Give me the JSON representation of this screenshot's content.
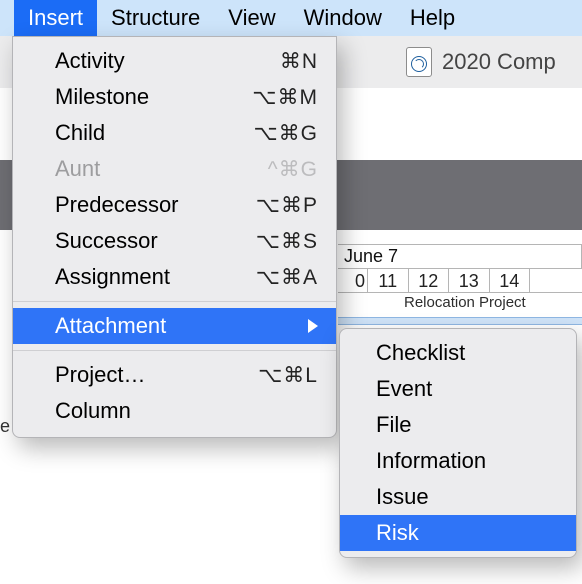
{
  "menubar": {
    "items": [
      {
        "label": "Insert",
        "active": true
      },
      {
        "label": "Structure"
      },
      {
        "label": "View"
      },
      {
        "label": "Window"
      },
      {
        "label": "Help"
      }
    ]
  },
  "toolbar": {
    "doc_title": "2020 Comp"
  },
  "calendar": {
    "month_label": "June 7",
    "days": [
      "0",
      "11",
      "12",
      "13",
      "14"
    ],
    "project_label": "Relocation Project"
  },
  "left_stub": "e",
  "insert_menu": {
    "items": [
      {
        "label": "Activity",
        "shortcut": "⌘N"
      },
      {
        "label": "Milestone",
        "shortcut": "⌥⌘M"
      },
      {
        "label": "Child",
        "shortcut": "⌥⌘G"
      },
      {
        "label": "Aunt",
        "shortcut": "^⌘G",
        "disabled": true
      },
      {
        "label": "Predecessor",
        "shortcut": "⌥⌘P"
      },
      {
        "label": "Successor",
        "shortcut": "⌥⌘S"
      },
      {
        "label": "Assignment",
        "shortcut": "⌥⌘A"
      }
    ],
    "attachment_label": "Attachment",
    "trailing_items": [
      {
        "label": "Project…",
        "shortcut": "⌥⌘L"
      },
      {
        "label": "Column"
      }
    ]
  },
  "attachment_submenu": {
    "items": [
      {
        "label": "Checklist"
      },
      {
        "label": "Event"
      },
      {
        "label": "File"
      },
      {
        "label": "Information"
      },
      {
        "label": "Issue"
      },
      {
        "label": "Risk",
        "highlight": true
      }
    ]
  }
}
